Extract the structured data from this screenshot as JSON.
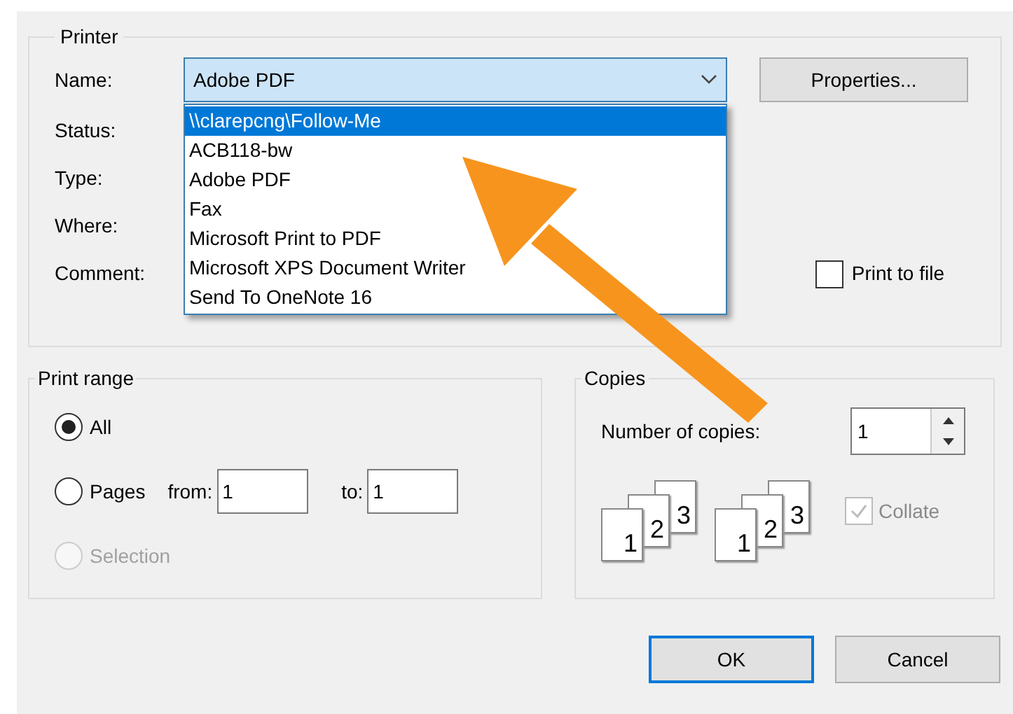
{
  "printer": {
    "title": "Printer",
    "name_label": "Name:",
    "selected_printer": "Adobe PDF",
    "properties_button": "Properties...",
    "info_labels": [
      "Status:",
      "Type:",
      "Where:",
      "Comment:"
    ],
    "print_to_file": {
      "label": "Print to file",
      "checked": false
    },
    "dropdown": {
      "expanded": true,
      "options": [
        {
          "label": "\\\\clarepcng\\Follow-Me",
          "selected": true
        },
        {
          "label": "ACB118-bw",
          "selected": false
        },
        {
          "label": "Adobe PDF",
          "selected": false
        },
        {
          "label": "Fax",
          "selected": false
        },
        {
          "label": "Microsoft Print to PDF",
          "selected": false
        },
        {
          "label": "Microsoft XPS Document Writer",
          "selected": false
        },
        {
          "label": "Send To OneNote 16",
          "selected": false
        }
      ]
    }
  },
  "print_range": {
    "title": "Print range",
    "options": [
      {
        "label": "All",
        "selected": true,
        "disabled": false
      },
      {
        "label": "Pages",
        "selected": false,
        "disabled": false
      },
      {
        "label": "Selection",
        "selected": false,
        "disabled": true
      }
    ],
    "from_label": "from:",
    "from_value": "1",
    "to_label": "to:",
    "to_value": "1"
  },
  "copies": {
    "title": "Copies",
    "number_label": "Number of copies:",
    "number_value": "1",
    "collate_icons": [
      {
        "pages": [
          "1",
          "2",
          "3"
        ]
      },
      {
        "pages": [
          "1",
          "2",
          "3"
        ]
      }
    ],
    "collate": {
      "label": "Collate",
      "checked": true,
      "disabled": true
    }
  },
  "buttons": [
    {
      "label": "OK",
      "default": true
    },
    {
      "label": "Cancel",
      "default": false
    }
  ],
  "annotation": {
    "kind": "arrow"
  }
}
